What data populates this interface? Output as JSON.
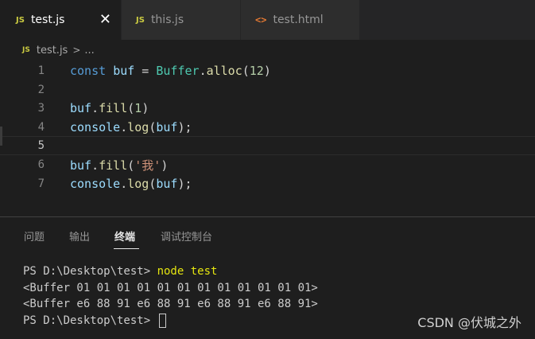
{
  "tabs": [
    {
      "icon": "JS",
      "label": "test.js",
      "close": "✕",
      "active": true
    },
    {
      "icon": "JS",
      "label": "this.js"
    },
    {
      "icon": "<>",
      "label": "test.html"
    }
  ],
  "breadcrumb": {
    "icon": "JS",
    "file": "test.js",
    "separator": ">",
    "more": "..."
  },
  "editor": {
    "current_line": 5,
    "lines": [
      {
        "n": "1",
        "tokens": [
          [
            "kw",
            "const"
          ],
          [
            "punc",
            " "
          ],
          [
            "var",
            "buf"
          ],
          [
            "punc",
            " = "
          ],
          [
            "cls",
            "Buffer"
          ],
          [
            "punc",
            "."
          ],
          [
            "fn",
            "alloc"
          ],
          [
            "punc",
            "("
          ],
          [
            "num",
            "12"
          ],
          [
            "punc",
            ")"
          ]
        ]
      },
      {
        "n": "2",
        "tokens": []
      },
      {
        "n": "3",
        "tokens": [
          [
            "var",
            "buf"
          ],
          [
            "punc",
            "."
          ],
          [
            "fn",
            "fill"
          ],
          [
            "punc",
            "("
          ],
          [
            "num",
            "1"
          ],
          [
            "punc",
            ")"
          ]
        ]
      },
      {
        "n": "4",
        "tokens": [
          [
            "var",
            "console"
          ],
          [
            "punc",
            "."
          ],
          [
            "fn",
            "log"
          ],
          [
            "punc",
            "("
          ],
          [
            "var",
            "buf"
          ],
          [
            "punc",
            ");"
          ]
        ]
      },
      {
        "n": "5",
        "tokens": []
      },
      {
        "n": "6",
        "tokens": [
          [
            "var",
            "buf"
          ],
          [
            "punc",
            "."
          ],
          [
            "fn",
            "fill"
          ],
          [
            "punc",
            "("
          ],
          [
            "str",
            "'我'"
          ],
          [
            "punc",
            ")"
          ]
        ]
      },
      {
        "n": "7",
        "tokens": [
          [
            "var",
            "console"
          ],
          [
            "punc",
            "."
          ],
          [
            "fn",
            "log"
          ],
          [
            "punc",
            "("
          ],
          [
            "var",
            "buf"
          ],
          [
            "punc",
            ");"
          ]
        ]
      }
    ]
  },
  "panel": {
    "tabs": [
      "问题",
      "输出",
      "终端",
      "调试控制台"
    ],
    "active_tab": "终端"
  },
  "terminal": {
    "prompt": "PS D:\\Desktop\\test> ",
    "command": "node test",
    "output": [
      "<Buffer 01 01 01 01 01 01 01 01 01 01 01 01>",
      "<Buffer e6 88 91 e6 88 91 e6 88 91 e6 88 91>"
    ],
    "prompt2": "PS D:\\Desktop\\test> "
  },
  "watermark": "CSDN @伏城之外",
  "colors": {
    "editor_bg": "#1e1e1e",
    "keyword": "#569cd6",
    "variable": "#9cdcfe",
    "class": "#4ec9b0",
    "function": "#dcdcaa",
    "number": "#b5cea8",
    "string": "#ce9178",
    "terminal_command": "#e5e510"
  }
}
